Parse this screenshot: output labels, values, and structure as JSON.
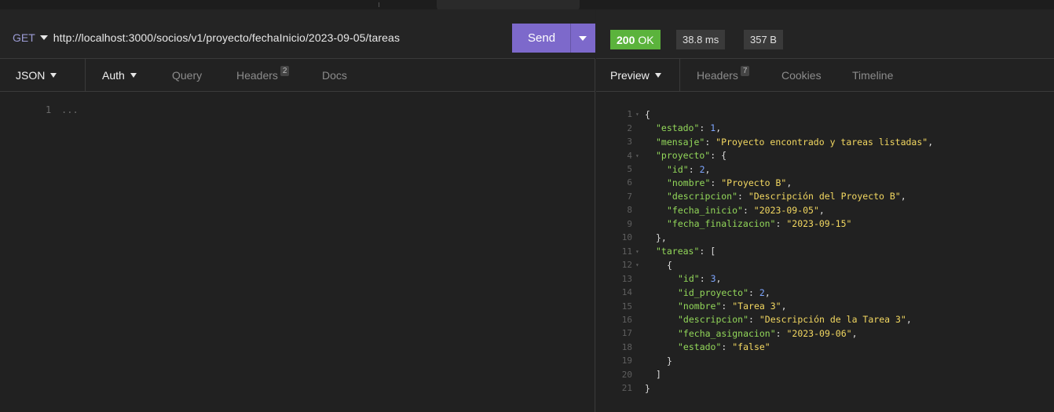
{
  "request": {
    "method": "GET",
    "url": "http://localhost:3000/socios/v1/proyecto/fechaInicio/2023-09-05/tareas",
    "send_label": "Send",
    "tabs": {
      "body": "JSON",
      "auth": "Auth",
      "query": "Query",
      "headers": "Headers",
      "headers_count": "2",
      "docs": "Docs"
    },
    "editor": {
      "line_number": "1",
      "placeholder": "..."
    }
  },
  "response": {
    "status_code": "200",
    "status_text": "OK",
    "time": "38.8 ms",
    "size": "357 B",
    "tabs": {
      "preview": "Preview",
      "headers": "Headers",
      "headers_count": "7",
      "cookies": "Cookies",
      "timeline": "Timeline"
    },
    "lines": [
      {
        "num": "1",
        "fold": true,
        "indent": 0,
        "parts": [
          [
            "p",
            "{"
          ]
        ]
      },
      {
        "num": "2",
        "fold": false,
        "indent": 1,
        "parts": [
          [
            "k",
            "\"estado\""
          ],
          [
            "p",
            ": "
          ],
          [
            "n",
            "1"
          ],
          [
            "p",
            ","
          ]
        ]
      },
      {
        "num": "3",
        "fold": false,
        "indent": 1,
        "parts": [
          [
            "k",
            "\"mensaje\""
          ],
          [
            "p",
            ": "
          ],
          [
            "s",
            "\"Proyecto encontrado y tareas listadas\""
          ],
          [
            "p",
            ","
          ]
        ]
      },
      {
        "num": "4",
        "fold": true,
        "indent": 1,
        "parts": [
          [
            "k",
            "\"proyecto\""
          ],
          [
            "p",
            ": {"
          ]
        ]
      },
      {
        "num": "5",
        "fold": false,
        "indent": 2,
        "parts": [
          [
            "k",
            "\"id\""
          ],
          [
            "p",
            ": "
          ],
          [
            "n",
            "2"
          ],
          [
            "p",
            ","
          ]
        ]
      },
      {
        "num": "6",
        "fold": false,
        "indent": 2,
        "parts": [
          [
            "k",
            "\"nombre\""
          ],
          [
            "p",
            ": "
          ],
          [
            "s",
            "\"Proyecto B\""
          ],
          [
            "p",
            ","
          ]
        ]
      },
      {
        "num": "7",
        "fold": false,
        "indent": 2,
        "parts": [
          [
            "k",
            "\"descripcion\""
          ],
          [
            "p",
            ": "
          ],
          [
            "s",
            "\"Descripción del Proyecto B\""
          ],
          [
            "p",
            ","
          ]
        ]
      },
      {
        "num": "8",
        "fold": false,
        "indent": 2,
        "parts": [
          [
            "k",
            "\"fecha_inicio\""
          ],
          [
            "p",
            ": "
          ],
          [
            "s",
            "\"2023-09-05\""
          ],
          [
            "p",
            ","
          ]
        ]
      },
      {
        "num": "9",
        "fold": false,
        "indent": 2,
        "parts": [
          [
            "k",
            "\"fecha_finalizacion\""
          ],
          [
            "p",
            ": "
          ],
          [
            "s",
            "\"2023-09-15\""
          ]
        ]
      },
      {
        "num": "10",
        "fold": false,
        "indent": 1,
        "parts": [
          [
            "p",
            "},"
          ]
        ]
      },
      {
        "num": "11",
        "fold": true,
        "indent": 1,
        "parts": [
          [
            "k",
            "\"tareas\""
          ],
          [
            "p",
            ": ["
          ]
        ]
      },
      {
        "num": "12",
        "fold": true,
        "indent": 2,
        "parts": [
          [
            "p",
            "{"
          ]
        ]
      },
      {
        "num": "13",
        "fold": false,
        "indent": 3,
        "parts": [
          [
            "k",
            "\"id\""
          ],
          [
            "p",
            ": "
          ],
          [
            "n",
            "3"
          ],
          [
            "p",
            ","
          ]
        ]
      },
      {
        "num": "14",
        "fold": false,
        "indent": 3,
        "parts": [
          [
            "k",
            "\"id_proyecto\""
          ],
          [
            "p",
            ": "
          ],
          [
            "n",
            "2"
          ],
          [
            "p",
            ","
          ]
        ]
      },
      {
        "num": "15",
        "fold": false,
        "indent": 3,
        "parts": [
          [
            "k",
            "\"nombre\""
          ],
          [
            "p",
            ": "
          ],
          [
            "s",
            "\"Tarea 3\""
          ],
          [
            "p",
            ","
          ]
        ]
      },
      {
        "num": "16",
        "fold": false,
        "indent": 3,
        "parts": [
          [
            "k",
            "\"descripcion\""
          ],
          [
            "p",
            ": "
          ],
          [
            "s",
            "\"Descripción de la Tarea 3\""
          ],
          [
            "p",
            ","
          ]
        ]
      },
      {
        "num": "17",
        "fold": false,
        "indent": 3,
        "parts": [
          [
            "k",
            "\"fecha_asignacion\""
          ],
          [
            "p",
            ": "
          ],
          [
            "s",
            "\"2023-09-06\""
          ],
          [
            "p",
            ","
          ]
        ]
      },
      {
        "num": "18",
        "fold": false,
        "indent": 3,
        "parts": [
          [
            "k",
            "\"estado\""
          ],
          [
            "p",
            ": "
          ],
          [
            "s",
            "\"false\""
          ]
        ]
      },
      {
        "num": "19",
        "fold": false,
        "indent": 2,
        "parts": [
          [
            "p",
            "}"
          ]
        ]
      },
      {
        "num": "20",
        "fold": false,
        "indent": 1,
        "parts": [
          [
            "p",
            "]"
          ]
        ]
      },
      {
        "num": "21",
        "fold": false,
        "indent": 0,
        "parts": [
          [
            "p",
            "}"
          ]
        ]
      }
    ]
  },
  "colors": {
    "send_button": "#7d69cb",
    "status_ok": "#5bb33c",
    "json_key": "#93d85a",
    "json_string": "#f3d861",
    "json_number": "#7ea6ff"
  }
}
